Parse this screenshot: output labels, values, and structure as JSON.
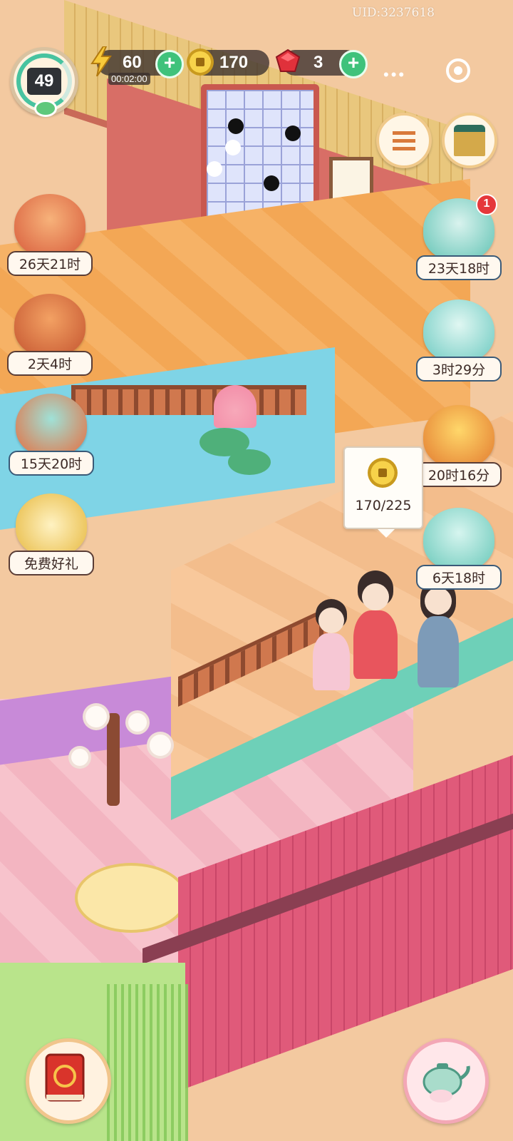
{
  "uid": "UID:3237618",
  "player": {
    "level": "49"
  },
  "resources": {
    "energy": {
      "value": "60",
      "timer": "00:02:00",
      "icon": "lightning-icon"
    },
    "coins": {
      "value": "170",
      "icon": "coin-icon"
    },
    "gems": {
      "value": "3",
      "icon": "ruby-icon"
    }
  },
  "top_right": {
    "more": "•••",
    "settings_icon": "settings-icon",
    "menu_icon": "list-icon",
    "shop_icon": "treasure-chest-icon"
  },
  "events_left": [
    {
      "name": "book-event",
      "timer": "26天21时"
    },
    {
      "name": "gift-box-event",
      "timer": "2天4时"
    },
    {
      "name": "trophy-event",
      "timer": "15天20时"
    },
    {
      "name": "free-gift-event",
      "timer": "免费好礼"
    }
  ],
  "events_right": [
    {
      "name": "cat-bath-event",
      "timer": "23天18时",
      "badge": "1"
    },
    {
      "name": "jade-box-event",
      "timer": "3时29分"
    },
    {
      "name": "coin-board-event",
      "timer": "20时16分"
    },
    {
      "name": "cat-gift-event",
      "timer": "6天18时"
    }
  ],
  "tooltip": {
    "value": "170/225",
    "icon": "coin-icon"
  },
  "bottom": {
    "left_icon": "storybook-icon",
    "right_icon": "teapot-icon"
  },
  "colors": {
    "accent_green": "#3fc27b",
    "hud_dark": "#3a302e",
    "badge_red": "#e5383b"
  }
}
